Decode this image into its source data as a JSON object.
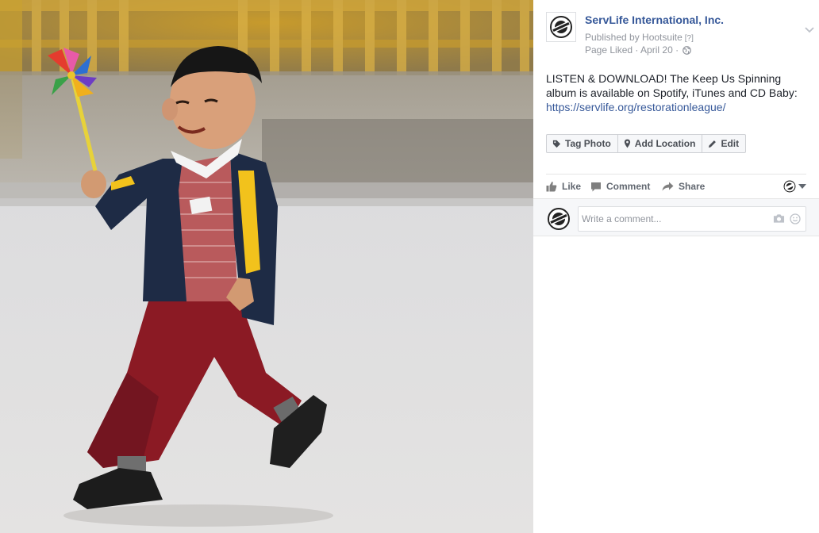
{
  "post": {
    "page_name": "ServLife International, Inc.",
    "published_by": "Published by Hootsuite",
    "help_mark": "[?]",
    "status": "Page Liked · April 20 ·",
    "globe_icon": "globe-icon",
    "menu_icon": "chevron-down-icon",
    "text": "LISTEN & DOWNLOAD! The Keep Us Spinning album is available on Spotify, iTunes and CD Baby:",
    "link": "https://servlife.org/restorationleague/"
  },
  "photo_tools": {
    "tag_photo": "Tag Photo",
    "add_location": "Add Location",
    "edit": "Edit"
  },
  "actions": {
    "like": "Like",
    "comment": "Comment",
    "share": "Share"
  },
  "comment_box": {
    "placeholder": "Write a comment..."
  },
  "colors": {
    "link": "#365899",
    "muted": "#90949c",
    "button_bg": "#f6f7f9",
    "border": "#dddfe2"
  }
}
